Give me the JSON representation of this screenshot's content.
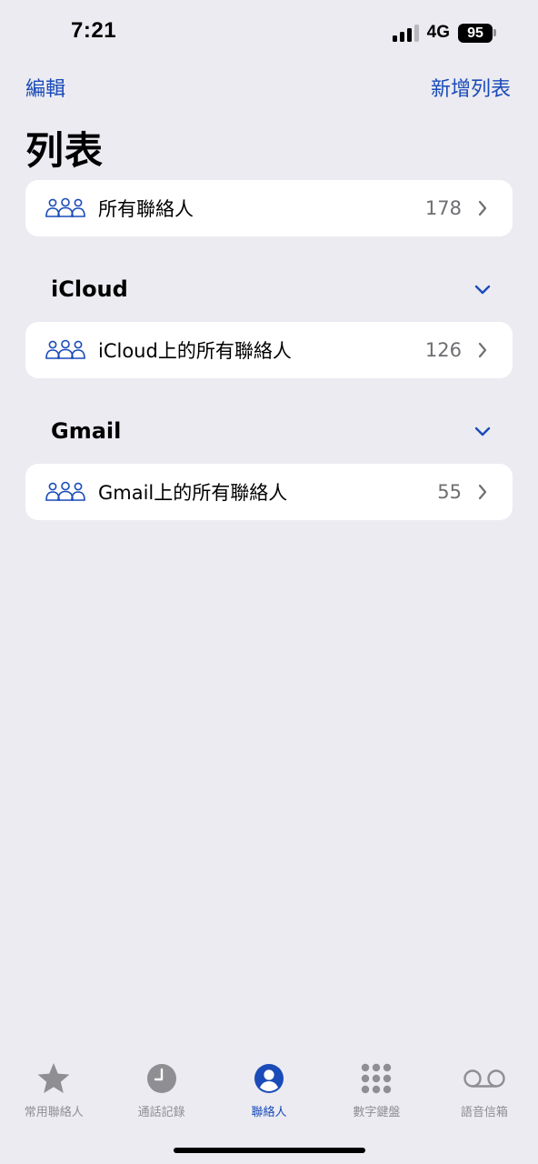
{
  "status_bar": {
    "time": "7:21",
    "network": "4G",
    "battery": "95",
    "signal_bars_active": 3
  },
  "nav": {
    "edit_label": "編輯",
    "add_list_label": "新增列表"
  },
  "title": "列表",
  "all_contacts": {
    "label": "所有聯絡人",
    "count": "178"
  },
  "sections": [
    {
      "title": "iCloud",
      "item": {
        "label": "iCloud上的所有聯絡人",
        "count": "126"
      }
    },
    {
      "title": "Gmail",
      "item": {
        "label": "Gmail上的所有聯絡人",
        "count": "55"
      }
    }
  ],
  "tabs": [
    {
      "label": "常用聯絡人",
      "icon": "star-icon",
      "active": false
    },
    {
      "label": "通話記錄",
      "icon": "clock-icon",
      "active": false
    },
    {
      "label": "聯絡人",
      "icon": "person-circle-icon",
      "active": true
    },
    {
      "label": "數字鍵盤",
      "icon": "keypad-icon",
      "active": false
    },
    {
      "label": "語音信箱",
      "icon": "voicemail-icon",
      "active": false
    }
  ],
  "colors": {
    "accent": "#1a4bb8",
    "background": "#ebebf1",
    "card": "#ffffff",
    "secondary_text": "#6e6e73",
    "inactive_tab": "#8e8e93"
  }
}
